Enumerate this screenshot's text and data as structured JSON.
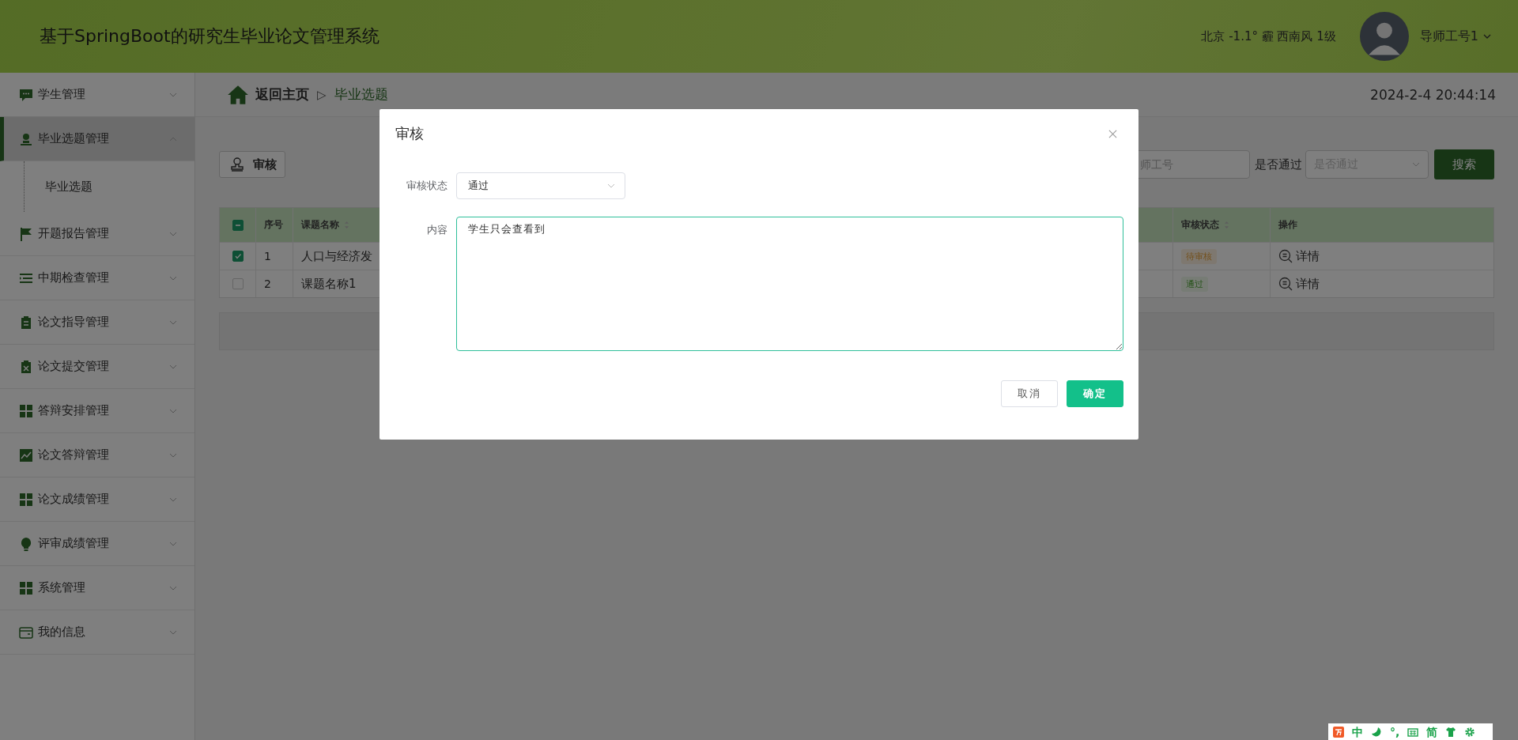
{
  "header": {
    "title": "基于SpringBoot的研究生毕业论文管理系统",
    "weather": "北京 -1.1° 霾 西南风 1级",
    "user": "导师工号1"
  },
  "sidebar": {
    "items": [
      {
        "label": "学生管理",
        "expanded": false,
        "selected": false
      },
      {
        "label": "毕业选题管理",
        "expanded": true,
        "selected": true,
        "children": [
          {
            "label": "毕业选题",
            "selected": false
          }
        ]
      },
      {
        "label": "开题报告管理",
        "expanded": false,
        "selected": false
      },
      {
        "label": "中期检查管理",
        "expanded": false,
        "selected": false
      },
      {
        "label": "论文指导管理",
        "expanded": false,
        "selected": false
      },
      {
        "label": "论文提交管理",
        "expanded": false,
        "selected": false
      },
      {
        "label": "答辩安排管理",
        "expanded": false,
        "selected": false
      },
      {
        "label": "论文答辩管理",
        "expanded": false,
        "selected": false
      },
      {
        "label": "论文成绩管理",
        "expanded": false,
        "selected": false
      },
      {
        "label": "评审成绩管理",
        "expanded": false,
        "selected": false
      },
      {
        "label": "系统管理",
        "expanded": false,
        "selected": false
      },
      {
        "label": "我的信息",
        "expanded": false,
        "selected": false
      }
    ]
  },
  "breadcrumb": {
    "home": "返回主页",
    "separator": "▷",
    "current": "毕业选题"
  },
  "datetime": "2024-2-4 20:44:14",
  "toolbar": {
    "audit_button": "审核",
    "teacher_field": {
      "placeholder": "师工号"
    },
    "pass_label": "是否通过",
    "pass_select": {
      "placeholder": "是否通过"
    },
    "search_button": "搜索"
  },
  "table": {
    "select_all_indeterminate": true,
    "columns": [
      {
        "label": "序号",
        "sortable": false
      },
      {
        "label": "课题名称",
        "sortable": true
      },
      {
        "label": "审核状态",
        "sortable": true
      },
      {
        "label": "操作",
        "sortable": false
      }
    ],
    "rows": [
      {
        "checked": true,
        "index": "1",
        "title": "人口与经济发",
        "status": {
          "text": "待审核",
          "kind": "pending"
        },
        "action": "详情"
      },
      {
        "checked": false,
        "index": "2",
        "title": "课题名称1",
        "status": {
          "text": "通过",
          "kind": "passed"
        },
        "action": "详情"
      }
    ]
  },
  "dialog": {
    "title": "审核",
    "fields": [
      {
        "kind": "select",
        "label": "审核状态",
        "value": "通过"
      },
      {
        "kind": "textarea",
        "label": "内容",
        "value": "学生只会查看到"
      }
    ],
    "buttons": [
      {
        "label": "取消",
        "kind": "default"
      },
      {
        "label": "确定",
        "kind": "primary"
      }
    ]
  },
  "ime_bar": {
    "items": [
      {
        "kind": "logo"
      },
      {
        "kind": "text",
        "text": "中"
      },
      {
        "kind": "moon"
      },
      {
        "kind": "text",
        "text": "°,"
      },
      {
        "kind": "keyboard"
      },
      {
        "kind": "text",
        "text": "简"
      },
      {
        "kind": "shirt"
      },
      {
        "kind": "gear"
      }
    ]
  }
}
